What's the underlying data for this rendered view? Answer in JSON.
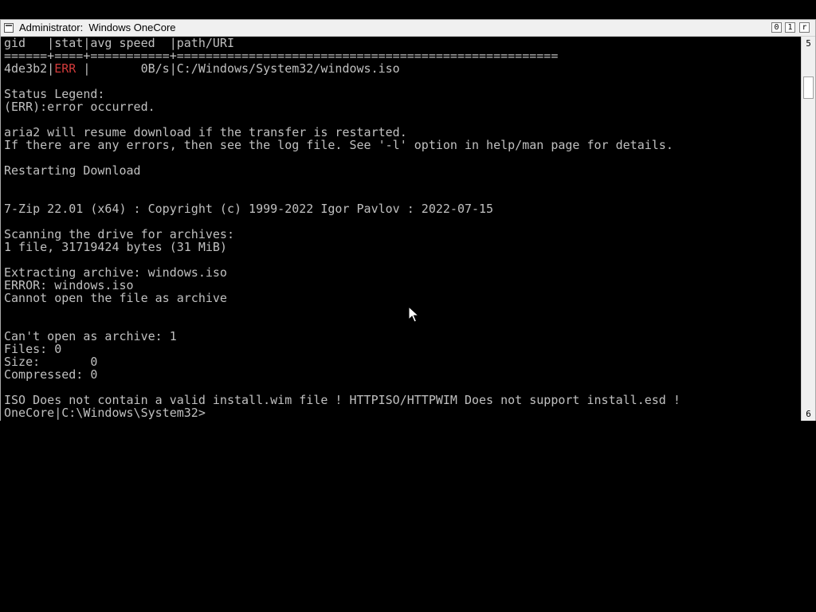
{
  "window": {
    "title": "Administrator:  Windows OneCore",
    "controls": {
      "minimize": "0",
      "maximize": "1",
      "close": "r"
    }
  },
  "scrollbar": {
    "up": "5",
    "down": "6"
  },
  "console": {
    "lines": [
      {
        "text": "gid   |stat|avg speed  |path/URI"
      },
      {
        "text": "======+====+===========+====================================================="
      },
      {
        "prefix": "4de3b2|",
        "err": "ERR ",
        "suffix": "|       0B/s|C:/Windows/System32/windows.iso"
      },
      {
        "text": ""
      },
      {
        "text": "Status Legend:"
      },
      {
        "text": "(ERR):error occurred."
      },
      {
        "text": ""
      },
      {
        "text": "aria2 will resume download if the transfer is restarted."
      },
      {
        "text": "If there are any errors, then see the log file. See '-l' option in help/man page for details."
      },
      {
        "text": ""
      },
      {
        "text": "Restarting Download"
      },
      {
        "text": ""
      },
      {
        "text": ""
      },
      {
        "text": "7-Zip 22.01 (x64) : Copyright (c) 1999-2022 Igor Pavlov : 2022-07-15"
      },
      {
        "text": ""
      },
      {
        "text": "Scanning the drive for archives:"
      },
      {
        "text": "1 file, 31719424 bytes (31 MiB)"
      },
      {
        "text": ""
      },
      {
        "text": "Extracting archive: windows.iso"
      },
      {
        "text": "ERROR: windows.iso"
      },
      {
        "text": "Cannot open the file as archive"
      },
      {
        "text": ""
      },
      {
        "text": ""
      },
      {
        "text": "Can't open as archive: 1"
      },
      {
        "text": "Files: 0"
      },
      {
        "text": "Size:       0"
      },
      {
        "text": "Compressed: 0"
      },
      {
        "text": ""
      },
      {
        "text": "ISO Does not contain a valid install.wim file ! HTTPISO/HTTPWIM Does not support install.esd !"
      },
      {
        "text": "OneCore|C:\\Windows\\System32>"
      }
    ]
  },
  "colors": {
    "console_text": "#c0c0c0",
    "console_bg": "#000000",
    "error_text": "#d23b3b",
    "chrome": "#f0f0f0"
  }
}
